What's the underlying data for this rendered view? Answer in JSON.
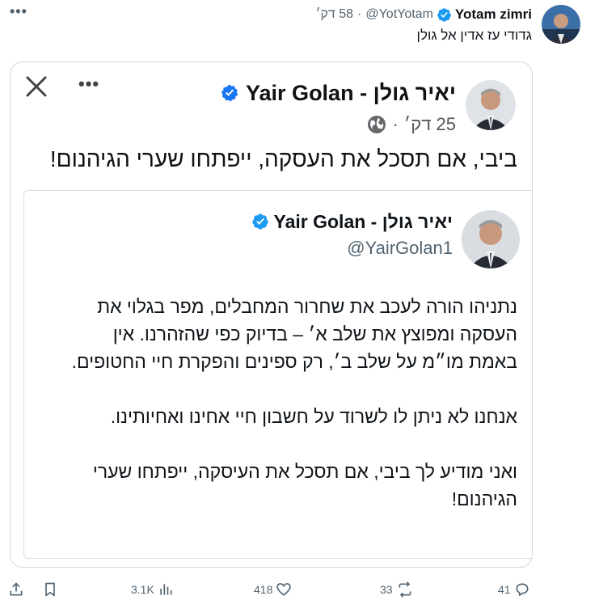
{
  "tweet": {
    "author_name": "Yotam zimri",
    "handle": "@YotYotam",
    "separator": "·",
    "time": "58 דק׳",
    "text": "גדודי עז אדין אל גולן",
    "more_icon": "more-horizontal-icon"
  },
  "media": {
    "close_icon": "close-icon",
    "more_icon": "more-horizontal-icon",
    "fb_post": {
      "author_name": "Yair Golan - יאיר גולן",
      "time": "25 דק׳",
      "separator": "·",
      "audience_icon": "globe-icon",
      "text": "ביבי, אם תסכל את העסקה, ייפתחו שערי הגיהנום!"
    },
    "embedded_tweet": {
      "author_name": "Yair Golan - יאיר גולן",
      "handle": "@YairGolan1",
      "paragraph1": {
        "line1": "נתניהו הורה לעכב את שחרור המחבלים, מפר בגלוי את",
        "line2": "העסקה ומפוצץ את שלב א׳ – בדיוק כפי שהזהרנו. אין",
        "line3": "באמת מו״מ על שלב ב׳, רק ספינים והפקרת חיי החטופים."
      },
      "paragraph2": {
        "line1": "אנחנו לא ניתן לו לשרוד על חשבון חיי אחינו ואחיותינו."
      },
      "paragraph3": {
        "line1": "ואני מודיע לך ביבי, אם תסכל את העיסקה, ייפתחו שערי",
        "line2": "הגיהנום!"
      }
    }
  },
  "actions": {
    "replies": "41",
    "reposts": "33",
    "likes": "418",
    "views": "3.1K"
  },
  "colors": {
    "verified_blue": "#1d9bf0",
    "secondary_text": "#536471",
    "border": "#cfd9de"
  }
}
